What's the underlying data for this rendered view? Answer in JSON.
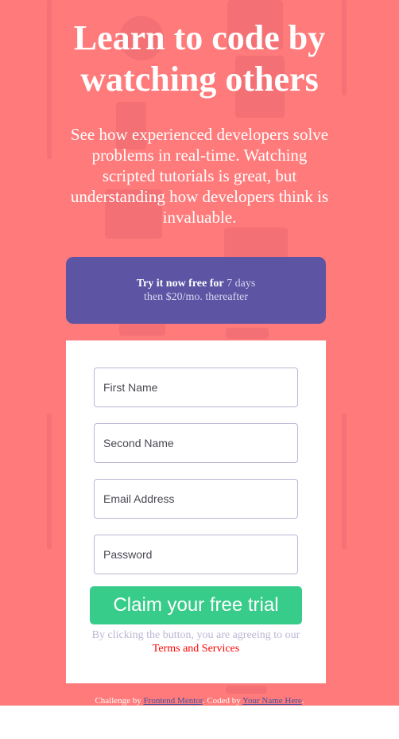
{
  "hero": {
    "title": "Learn to code by watching others",
    "intro": "See how experienced developers solve problems in real-time. Watching scripted tutorials is great, but understanding how developers think is invaluable."
  },
  "offer": {
    "bold_text": "Try it now free for",
    "days_text": "7 days",
    "price_text": "then $20/mo. thereafter"
  },
  "form": {
    "first_name_placeholder": "First Name",
    "second_name_placeholder": "Second Name",
    "email_placeholder": "Email Address",
    "password_placeholder": "Password",
    "submit_label": "Claim your free trial",
    "terms_prefix": "By clicking the button, you are agreeing to our",
    "terms_link": "Terms and Services"
  },
  "footer": {
    "challenge_prefix": "Challenge by",
    "challenge_link": "Frontend Mentor",
    "coded_prefix": ". Coded by",
    "coded_link": "Your Name Here",
    "suffix": "."
  },
  "colors": {
    "background": "#ff7a7a",
    "offer_panel": "#5d54a4",
    "button": "#38cc8b",
    "terms_link": "#ff0000",
    "field_border": "#b9b6d3"
  }
}
